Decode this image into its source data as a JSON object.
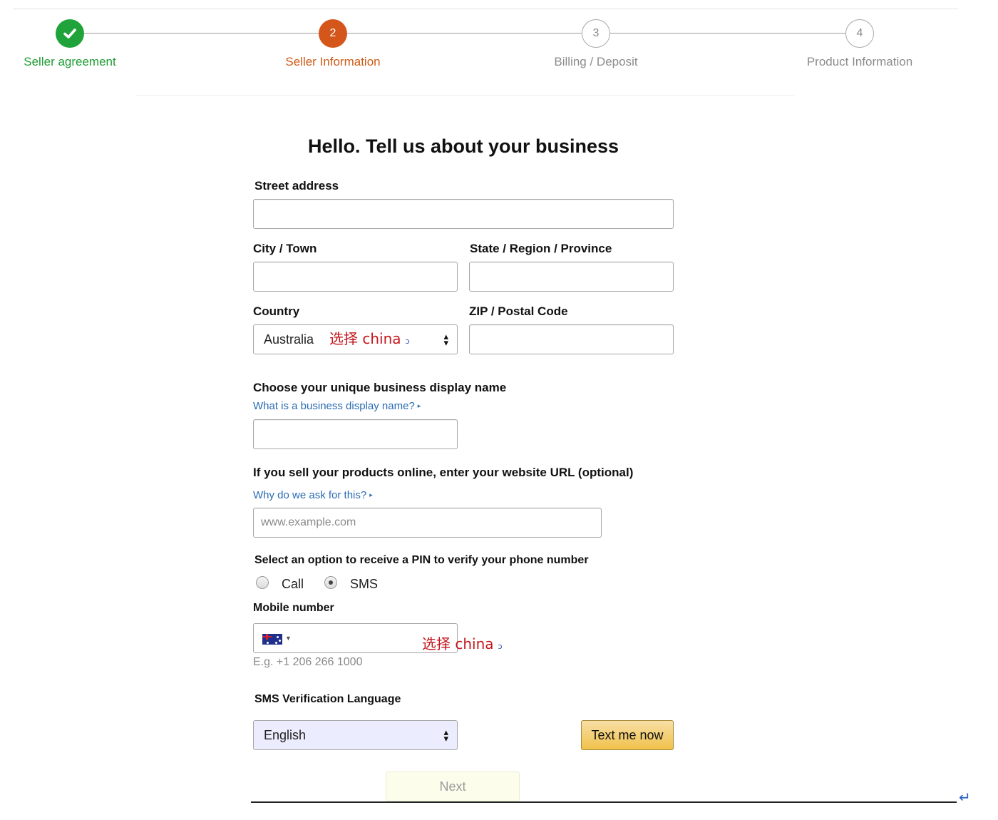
{
  "stepper": {
    "steps": [
      {
        "number": "1",
        "label": "Seller agreement",
        "state": "done"
      },
      {
        "number": "2",
        "label": "Seller Information",
        "state": "active"
      },
      {
        "number": "3",
        "label": "Billing / Deposit",
        "state": "todo"
      },
      {
        "number": "4",
        "label": "Product Information",
        "state": "todo"
      }
    ]
  },
  "form": {
    "heading": "Hello. Tell us about your business",
    "street_label": "Street address",
    "street_value": "",
    "city_label": "City / Town",
    "city_value": "",
    "state_label": "State / Region / Province",
    "state_value": "",
    "country_label": "Country",
    "country_selected": "Australia",
    "country_annotation": "选择 china",
    "zip_label": "ZIP / Postal Code",
    "zip_value": "",
    "display_name_label": "Choose your unique business display name",
    "display_name_link": "What is a business display name?",
    "display_name_value": "",
    "website_label": "If you sell your products online, enter your website URL (optional)",
    "website_link": "Why do we ask for this?",
    "website_placeholder": "www.example.com",
    "pin_label": "Select an option to receive a PIN to verify your phone number",
    "pin_options": [
      "Call",
      "SMS"
    ],
    "pin_selected": "SMS",
    "mobile_label": "Mobile number",
    "mobile_annotation": "选择 china",
    "mobile_example": "E.g. +1 206 266 1000",
    "sms_language_label": "SMS Verification Language",
    "sms_language_selected": "English",
    "text_me_button": "Text me now",
    "next_button": "Next"
  },
  "colors": {
    "done": "#1fa33a",
    "active": "#d4561b",
    "link": "#2a6cb5",
    "annotation": "#c4161c",
    "button_yellow": "#f0c14b"
  }
}
